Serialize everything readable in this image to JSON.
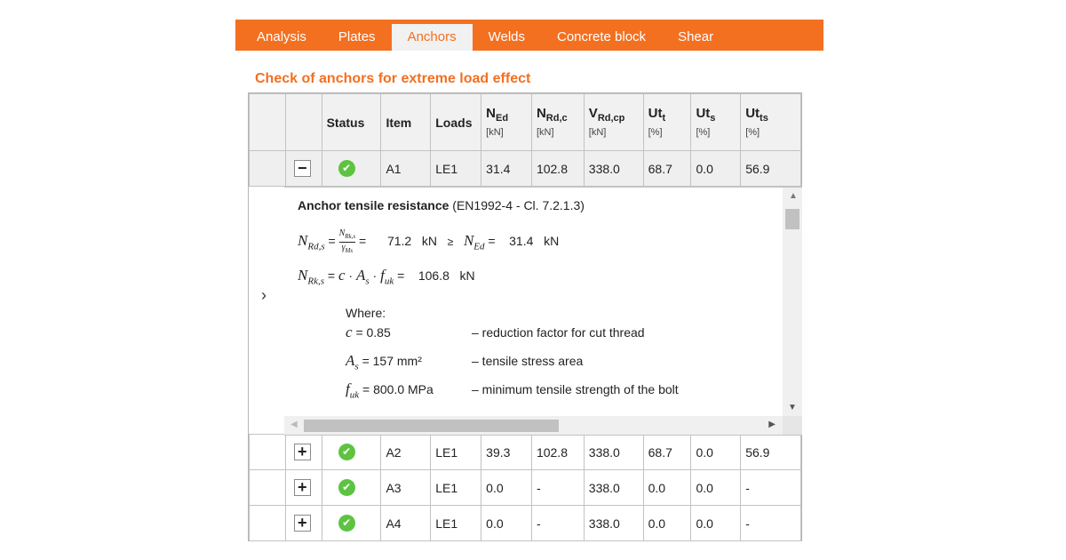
{
  "tabs": [
    {
      "label": "Analysis",
      "active": false
    },
    {
      "label": "Plates",
      "active": false
    },
    {
      "label": "Anchors",
      "active": true
    },
    {
      "label": "Welds",
      "active": false
    },
    {
      "label": "Concrete block",
      "active": false
    },
    {
      "label": "Shear",
      "active": false
    }
  ],
  "section_title": "Check of anchors for extreme load effect",
  "table": {
    "headers": {
      "status": "Status",
      "item": "Item",
      "loads": "Loads",
      "ned": {
        "main": "N",
        "sub": "Ed",
        "unit": "[kN]"
      },
      "nrdc": {
        "main": "N",
        "sub": "Rd,c",
        "unit": "[kN]"
      },
      "vrdcp": {
        "main": "V",
        "sub": "Rd,cp",
        "unit": "[kN]"
      },
      "utt": {
        "main": "Ut",
        "sub": "t",
        "unit": "[%]"
      },
      "uts": {
        "main": "Ut",
        "sub": "s",
        "unit": "[%]"
      },
      "utts": {
        "main": "Ut",
        "sub": "ts",
        "unit": "[%]"
      }
    },
    "rows": [
      {
        "toggle": "−",
        "status": "ok",
        "item": "A1",
        "loads": "LE1",
        "ned": "31.4",
        "nrdc": "102.8",
        "vrdcp": "338.0",
        "utt": "68.7",
        "uts": "0.0",
        "utts": "56.9"
      },
      {
        "toggle": "+",
        "status": "ok",
        "item": "A2",
        "loads": "LE1",
        "ned": "39.3",
        "nrdc": "102.8",
        "vrdcp": "338.0",
        "utt": "68.7",
        "uts": "0.0",
        "utts": "56.9"
      },
      {
        "toggle": "+",
        "status": "ok",
        "item": "A3",
        "loads": "LE1",
        "ned": "0.0",
        "nrdc": "-",
        "vrdcp": "338.0",
        "utt": "0.0",
        "uts": "0.0",
        "utts": "-"
      },
      {
        "toggle": "+",
        "status": "ok",
        "item": "A4",
        "loads": "LE1",
        "ned": "0.0",
        "nrdc": "-",
        "vrdcp": "338.0",
        "utt": "0.0",
        "uts": "0.0",
        "utts": "-"
      }
    ]
  },
  "detail": {
    "heading": "Anchor tensile resistance",
    "reference": "(EN1992-4 - Cl. 7.2.1.3)",
    "eq1_value": "71.2",
    "eq1_unit": "kN",
    "eq1_rel": "≥",
    "eq1_ned": "31.4",
    "eq1_ned_unit": "kN",
    "eq2_value": "106.8",
    "eq2_unit": "kN",
    "where": "Where:",
    "vars": [
      {
        "symbol": "c",
        "value": "= 0.85",
        "desc": "– reduction factor for cut thread"
      },
      {
        "symbol": "A",
        "sub": "s",
        "value": "= 157 mm²",
        "desc": "– tensile stress area"
      },
      {
        "symbol": "f",
        "sub": "uk",
        "value": "= 800.0 MPa",
        "desc": "– minimum tensile strength of the bolt"
      }
    ]
  }
}
